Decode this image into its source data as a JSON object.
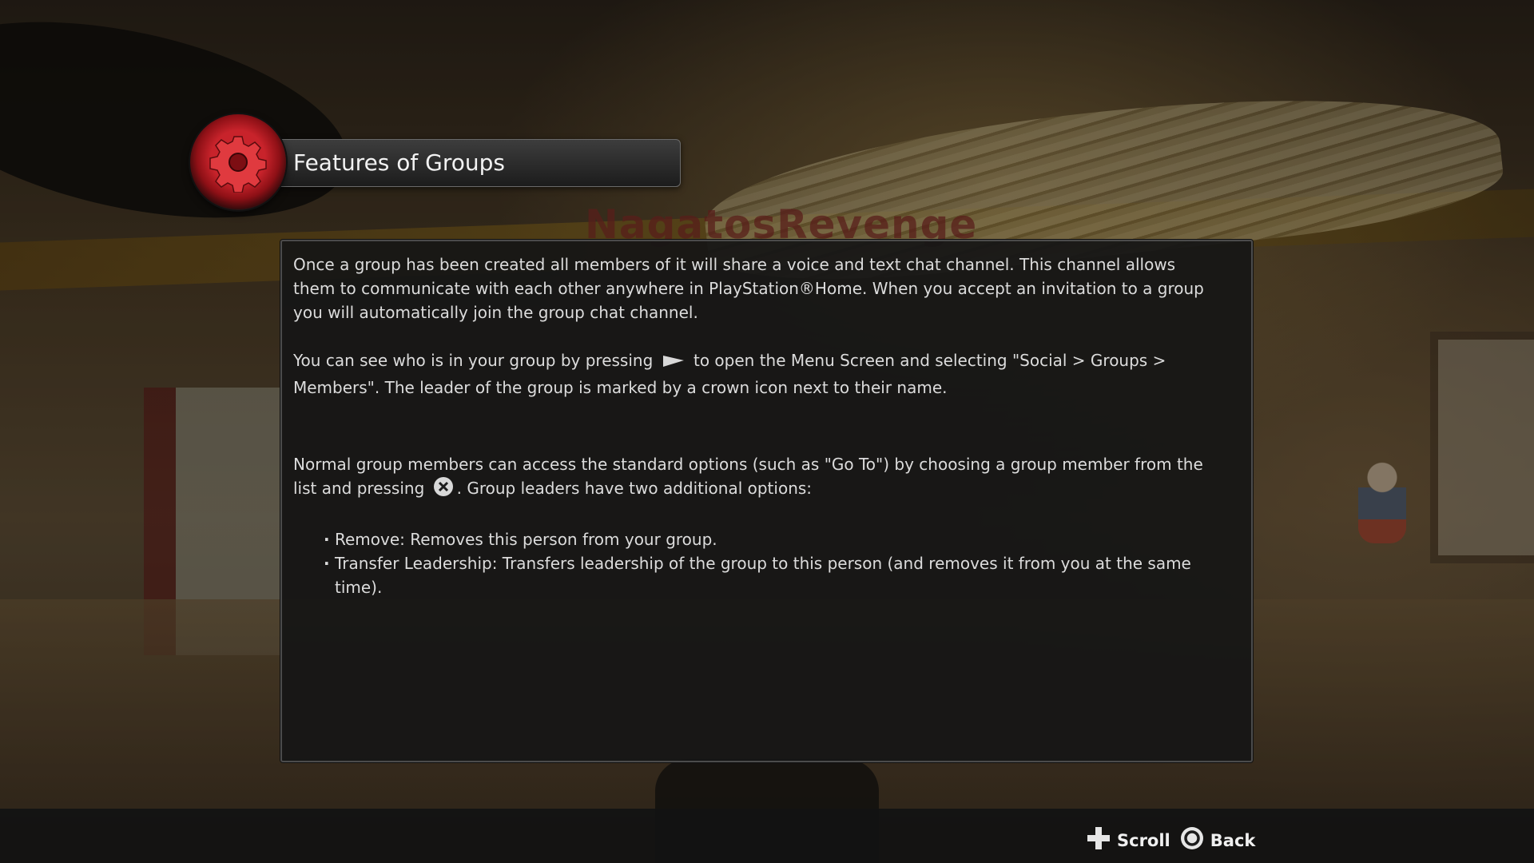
{
  "title": "Features of Groups",
  "title_icon": "gear-icon",
  "background_watermark": "NagatosRevenge",
  "paragraphs": {
    "p1": "Once a group has been created all members of it will share a voice and text chat channel.  This channel allows them to communicate with each other anywhere in PlayStation®Home.  When you accept an invitation to a group you will automatically join the group chat channel.",
    "p2_before": "You can see who is in your group by pressing",
    "p2_icon": "start-button-icon",
    "p2_after": "to open the Menu Screen and selecting \"Social > Groups > Members\".  The leader of the group is marked by a crown icon next to their name.",
    "p3_before": "Normal group members can access the standard options (such as \"Go To\") by choosing a group member from the list and pressing",
    "p3_icon": "cross-button-icon",
    "p3_after": ".  Group leaders have two additional options:"
  },
  "bullets": [
    "Remove: Removes this person from your group.",
    "Transfer Leadership: Transfers leadership of the group to this person (and removes it from you at the same time)."
  ],
  "footer": {
    "scroll_label": "Scroll",
    "scroll_icon": "dpad-icon",
    "back_label": "Back",
    "back_icon": "circle-button-icon"
  },
  "colors": {
    "badge_red": "#c8232b",
    "panel_bg": "#161616",
    "text": "#dcdcdc"
  }
}
